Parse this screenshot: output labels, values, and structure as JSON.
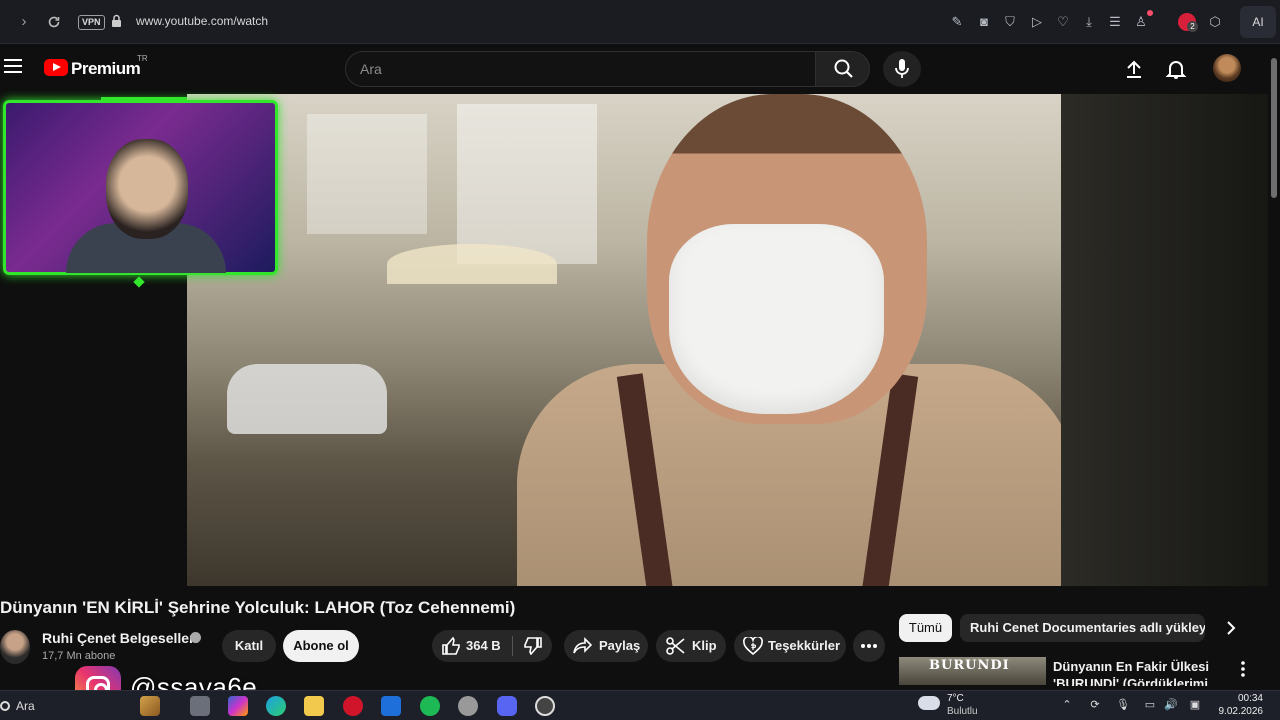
{
  "browser": {
    "url": "www.youtube.com/watch",
    "vpn_label": "VPN",
    "ai_label": "AI",
    "notification_count": "2"
  },
  "header": {
    "brand": "Premium",
    "region": "TR",
    "search_placeholder": "Ara"
  },
  "video": {
    "title": "Dünyanın 'EN KİRLİ' Şehrine Yolculuk: LAHOR (Toz Cehennemi)",
    "channel_name": "Ruhi Çenet Belgeselleri",
    "subscribers": "17,7 Mn abone",
    "join_label": "Katıl",
    "subscribe_label": "Abone ol",
    "like_count": "364 B",
    "share_label": "Paylaş",
    "clip_label": "Klip",
    "thanks_label": "Teşekkürler"
  },
  "sidebar": {
    "chips": [
      {
        "label": "Tümü",
        "selected": true
      },
      {
        "label": "Ruhi Cenet Documentaries adlı yükleyiciden"
      }
    ],
    "recommended": {
      "thumb_text": "BURUNDI",
      "title": "Dünyanın En Fakir Ülkesi 'BURUNDİ' (Gördüklerimi Açla"
    }
  },
  "overlay": {
    "instagram_handle": "@ssava6e"
  },
  "taskbar": {
    "search_label": "Ara",
    "temperature": "7°C",
    "condition": "Bulutlu",
    "time": "00:34",
    "date": "9.02.2026"
  },
  "colors": {
    "yt_red": "#ff0000",
    "cam_border": "#32e62c",
    "page_bg": "#0f0f0f",
    "pill_bg": "#272727"
  }
}
